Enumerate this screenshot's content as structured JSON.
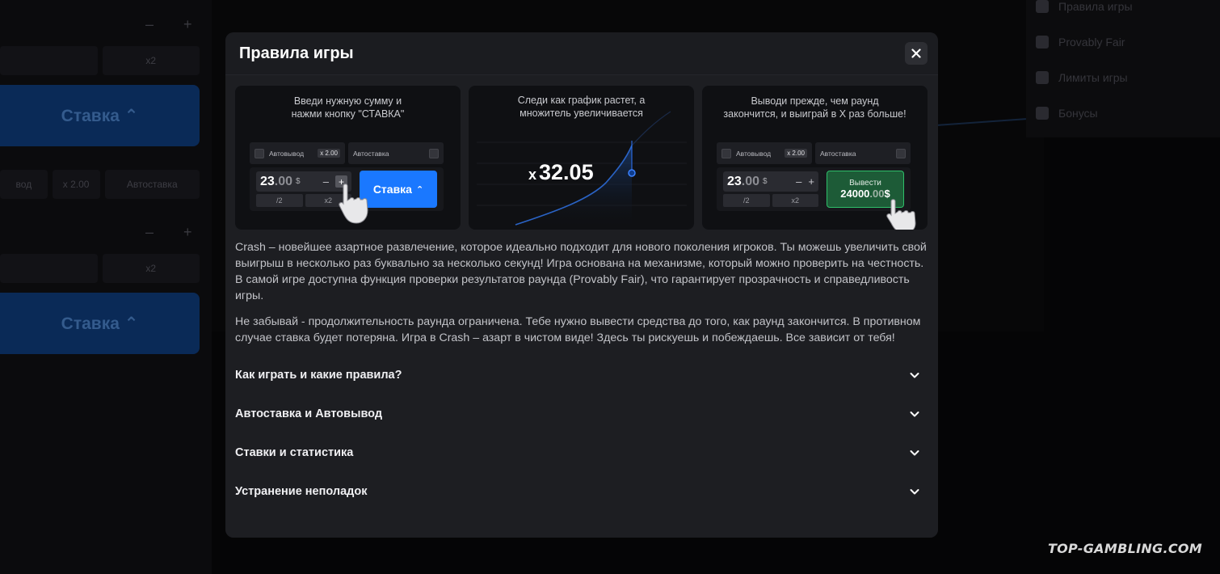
{
  "modal": {
    "title": "Правила игры",
    "close_icon": "close-icon"
  },
  "cards": [
    {
      "caption_line1": "Введи нужную сумму и",
      "caption_line2": "нажми кнопку \"СТАВКА\"",
      "autocashout_label": "Автовывод",
      "autocashout_chip": "x 2.00",
      "autobet_label": "Автоставка",
      "amount_int": "23",
      "amount_dec": ".00",
      "currency": "$",
      "minus": "–",
      "plus": "+",
      "half": "/2",
      "double": "x2",
      "bet_button": "Ставка",
      "caret": "⌃"
    },
    {
      "caption_line1": "Следи как график растет, а",
      "caption_line2": "множитель увеличивается",
      "multiplier_prefix": "x",
      "multiplier_value": "32.05"
    },
    {
      "caption_line1": "Выводи прежде, чем раунд",
      "caption_line2": "закончится, и выиграй в X раз больше!",
      "autocashout_label": "Автовывод",
      "autocashout_chip": "x 2.00",
      "autobet_label": "Автоставка",
      "amount_int": "23",
      "amount_dec": ".00",
      "currency": "$",
      "minus": "–",
      "plus": "+",
      "half": "/2",
      "double": "x2",
      "cashout_label": "Вывести",
      "cashout_int": "24000",
      "cashout_dec": ".00",
      "cashout_currency": "$"
    }
  ],
  "description": {
    "paragraph1": "Crash – новейшее азартное развлечение, которое идеально подходит для нового поколения игроков. Ты можешь увеличить свой выигрыш в несколько раз буквально за несколько секунд! Игра основана на механизме, который можно проверить на честность. В самой игре доступна функция проверки результатов раунда (Provably Fair), что гарантирует прозрачность и справедливость игры.",
    "paragraph2": "Не забывай - продолжительность раунда ограничена. Тебе нужно вывести средства до того, как раунд закончится. В противном случае ставка будет потеряна. Игра в Crash – азарт в чистом виде! Здесь ты рискуешь и побеждаешь. Все зависит от тебя!"
  },
  "faq": [
    {
      "label": "Как играть и какие правила?"
    },
    {
      "label": "Автоставка и Автовывод"
    },
    {
      "label": "Ставки и статистика"
    },
    {
      "label": "Устранение неполадок"
    }
  ],
  "background": {
    "bet_button": "Ставка ⌃",
    "double": "x2",
    "chip": "x 2.00",
    "autobet": "Автоставка",
    "half_fragment": "вод",
    "plus_minus": "– +",
    "menu": [
      "Правила игры",
      "Provably Fair",
      "Лимиты игры",
      "Бонусы"
    ]
  },
  "watermark": "TOP-GAMBLING.COM",
  "colors": {
    "accent_blue": "#1a78ff",
    "cashout_green": "#2fbf6a",
    "modal_bg": "#1b1c20"
  }
}
